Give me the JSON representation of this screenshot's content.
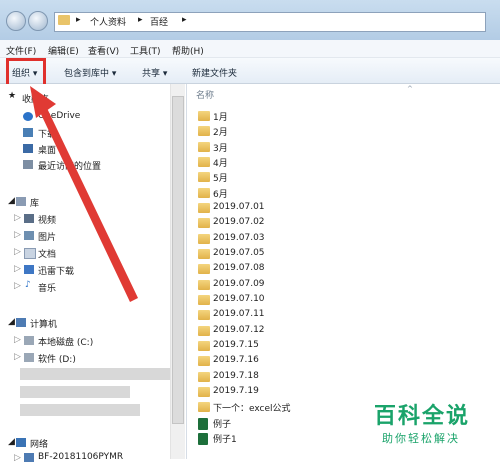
{
  "address": {
    "segments": [
      "个人资料",
      "百经"
    ]
  },
  "menubar": [
    "文件(F)",
    "编辑(E)",
    "查看(V)",
    "工具(T)",
    "帮助(H)"
  ],
  "toolbar": {
    "organize": "组织 ▾",
    "include": "包含到库中 ▾",
    "share": "共享 ▾",
    "newfolder": "新建文件夹"
  },
  "nav": {
    "favorites": "收藏夹",
    "fav_items": [
      "OneDrive",
      "下载",
      "桌面",
      "最近访问的位置"
    ],
    "libraries": "库",
    "lib_items": [
      "视频",
      "图片",
      "文档",
      "迅雷下载",
      "音乐"
    ],
    "computer": "计算机",
    "comp_items": [
      "本地磁盘 (C:)",
      "软件 (D:)"
    ],
    "network": "网络",
    "net_items": [
      "BF-20181106PYMR"
    ]
  },
  "content": {
    "column": "名称",
    "items": [
      "1月",
      "2月",
      "3月",
      "4月",
      "5月",
      "6月",
      "2019.07.01",
      "2019.07.02",
      "2019.07.03",
      "2019.07.05",
      "2019.07.08",
      "2019.07.09",
      "2019.07.10",
      "2019.07.11",
      "2019.07.12",
      "2019.7.15",
      "2019.7.16",
      "2019.7.18",
      "2019.7.19",
      "下一个：excel公式",
      "例子",
      "例子1"
    ]
  },
  "watermark": {
    "line1": "百科全说",
    "line2": "助你轻松解决"
  },
  "colors": {
    "highlight_red": "#e0302c",
    "watermark_green": "#1aa36a",
    "folder_yellow": "#e9c46a"
  }
}
